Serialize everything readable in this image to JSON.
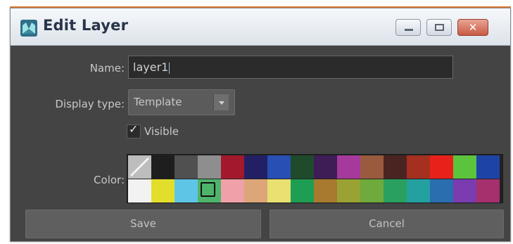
{
  "window": {
    "title": "Edit Layer",
    "close_glyph": "✕"
  },
  "form": {
    "name_label": "Name:",
    "name_value": "layer1",
    "display_type_label": "Display type:",
    "display_type_value": "Template",
    "visible_label": "Visible",
    "visible_checked": true,
    "checkmark_glyph": "✓",
    "color_label": "Color:"
  },
  "palette": {
    "rows": [
      [
        "none",
        "#1e1e1e",
        "#505050",
        "#8e8e8e",
        "#a1192a",
        "#231f64",
        "#274fb4",
        "#1f4a2c",
        "#3e1c56",
        "#a63a9c",
        "#9a5a3e",
        "#4a2420",
        "#a5301f",
        "#e8221a",
        "#5cc33c",
        "#1e43a6"
      ],
      [
        "#f2f2f2",
        "#e3de2b",
        "#5ec5e6",
        "#4fb46b",
        "#f0a0a8",
        "#dca678",
        "#e8e070",
        "#1e9e52",
        "#a87a30",
        "#9aa234",
        "#6eaa3c",
        "#2aa060",
        "#24a0a0",
        "#2a6eb0",
        "#7a3cb0",
        "#a6306e"
      ]
    ],
    "selected": {
      "row": 1,
      "col": 3
    }
  },
  "buttons": {
    "save": "Save",
    "cancel": "Cancel"
  },
  "colors": {
    "dialog_bg": "#444444",
    "title_text": "#27344a",
    "label_text": "#c8c8c8",
    "accent_top": "#e8843a"
  }
}
